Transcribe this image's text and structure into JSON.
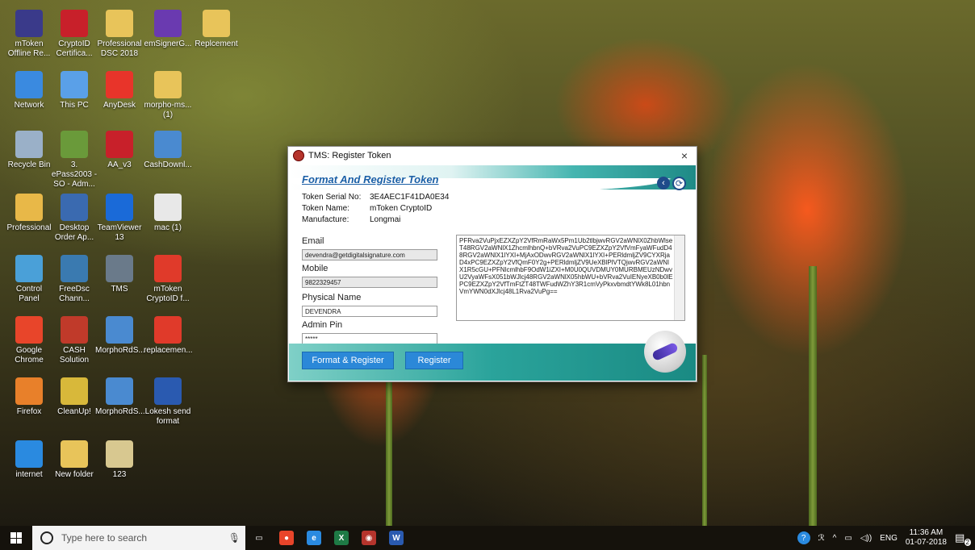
{
  "desktop": {
    "icons": [
      {
        "label": "mToken Offline Re...",
        "icon": "mtoken-icon",
        "color": "#3a3a8a"
      },
      {
        "label": "CryptoID Certifica...",
        "icon": "cryptoid-icon",
        "color": "#c8202a"
      },
      {
        "label": "Professional DSC 2018",
        "icon": "folder-zip-icon",
        "color": "#e8c45a"
      },
      {
        "label": "emSignerG...",
        "icon": "emsigner-icon",
        "color": "#6a3ab0"
      },
      {
        "label": "Replcement",
        "icon": "folder-zip-icon",
        "color": "#e8c45a"
      },
      {
        "label": "Network",
        "icon": "network-icon",
        "color": "#3a8ae0"
      },
      {
        "label": "This PC",
        "icon": "pc-icon",
        "color": "#5aa0e8"
      },
      {
        "label": "AnyDesk",
        "icon": "anydesk-icon",
        "color": "#e8342a"
      },
      {
        "label": "morpho-ms... (1)",
        "icon": "folder-zip-icon",
        "color": "#e8c45a"
      },
      {
        "label": "Recycle Bin",
        "icon": "recycle-bin-icon",
        "color": "#9ab0c8"
      },
      {
        "label": "3. ePass2003 - SO - Adm...",
        "icon": "epass-icon",
        "color": "#6a9a3a"
      },
      {
        "label": "AA_v3",
        "icon": "pdf-app-icon",
        "color": "#c8202a"
      },
      {
        "label": "CashDownl...",
        "icon": "installer-icon",
        "color": "#4a8ad0"
      },
      {
        "label": "Professional",
        "icon": "folder-user-icon",
        "color": "#e8b848"
      },
      {
        "label": "Desktop Order Ap...",
        "icon": "app-icon",
        "color": "#3a6ab0"
      },
      {
        "label": "TeamViewer 13",
        "icon": "teamviewer-icon",
        "color": "#1a6ad8"
      },
      {
        "label": "mac (1)",
        "icon": "file-icon",
        "color": "#e8e8e8"
      },
      {
        "label": "Control Panel",
        "icon": "control-panel-icon",
        "color": "#4aa0d8"
      },
      {
        "label": "FreeDsc Chann...",
        "icon": "freedsc-icon",
        "color": "#3a7ab0"
      },
      {
        "label": "TMS",
        "icon": "tms-icon",
        "color": "#6a7a8a"
      },
      {
        "label": "mToken CryptoID f...",
        "icon": "pdf-icon",
        "color": "#e03a2a"
      },
      {
        "label": "Google Chrome",
        "icon": "chrome-icon",
        "color": "#e8452a"
      },
      {
        "label": "CASH Solution",
        "icon": "cash-icon",
        "color": "#c03a2a"
      },
      {
        "label": "MorphoRdS...",
        "icon": "installer-icon",
        "color": "#4a8ad0"
      },
      {
        "label": "replacemen...",
        "icon": "pdf-icon",
        "color": "#e03a2a"
      },
      {
        "label": "Firefox",
        "icon": "firefox-icon",
        "color": "#e8802a"
      },
      {
        "label": "CleanUp!",
        "icon": "cleanup-icon",
        "color": "#d8b83a"
      },
      {
        "label": "MorphoRdS...",
        "icon": "installer-icon",
        "color": "#4a8ad0"
      },
      {
        "label": "Lokesh send format",
        "icon": "word-icon",
        "color": "#2a5ab0"
      },
      {
        "label": "internet",
        "icon": "ie-icon",
        "color": "#2a8ae0"
      },
      {
        "label": "New folder",
        "icon": "folder-icon",
        "color": "#e8c45a"
      },
      {
        "label": "123",
        "icon": "certificate-icon",
        "color": "#d8c890"
      }
    ]
  },
  "dialog": {
    "title": "TMS: Register Token",
    "close_glyph": "×",
    "header_title": "Format And Register Token",
    "back_glyph": "‹",
    "info": [
      {
        "label": "Token Serial No:",
        "value": "3E4AEC1F41DA0E34"
      },
      {
        "label": "Token Name:",
        "value": "mToken CryptoID"
      },
      {
        "label": "Manufacture:",
        "value": "Longmai"
      }
    ],
    "fields": {
      "email_label": "Email",
      "email_value": "devendra@getdigitalsignature.com",
      "mobile_label": "Mobile",
      "mobile_value": "9822329457",
      "physical_name_label": "Physical Name",
      "physical_name_value": "DEVENDRA",
      "admin_pin_label": "Admin Pin",
      "admin_pin_value": "*****"
    },
    "textarea_value": "PFRva2VuPjxEZXZpY2VfRmRaWx5Pm1Ub2tlbjwvRGV2aWNlX0ZhbWlseT48RGV2aWNlX1ZhcmlhbnQ+bVRva2VuPC9EZXZpY2VfVmFyaWFudD48RGV2aWNlX1lYXI+MjAxODwvRGV2aWNlX1lYXI+PERldmljZV9CYXRjaD4xPC9EZXZpY2VfQmF0Y2g+PERldmljZV9UeXBlPlVTQjwvRGV2aWNlX1R5cGU+PFNlcmlhbF9OdW1iZXI+M0U0QUVDMUY0MURBMEUzNDwvU2VyaWFsX051bWJlcj48RGV2aWNlX05hbWU+bVRva2VuIENyeXB0b0lEPC9EZXZpY2VfTmFtZT48TWFudWZhY3R1cmVyPkxvbmdtYWk8L01hbnVmYWN0dXJlcj48L1Rva2VuPg==",
    "buttons": {
      "format_register": "Format & Register",
      "register": "Register"
    }
  },
  "taskbar": {
    "search_placeholder": "Type here to search",
    "apps": [
      {
        "name": "task-view",
        "glyph": "▭",
        "color": "#15120c"
      },
      {
        "name": "chrome",
        "glyph": "●",
        "color": "#e8452a"
      },
      {
        "name": "ie",
        "glyph": "e",
        "color": "#2a8ae0"
      },
      {
        "name": "excel",
        "glyph": "X",
        "color": "#1e7a45"
      },
      {
        "name": "tms",
        "glyph": "◉",
        "color": "#b5342c"
      },
      {
        "name": "word",
        "glyph": "W",
        "color": "#2a5ab0"
      }
    ],
    "tray": {
      "user_glyph": "ℛ",
      "chevron": "^",
      "battery_glyph": "▭",
      "volume_glyph": "◁))",
      "language": "ENG",
      "time": "11:36 AM",
      "date": "01-07-2018",
      "notifications": "2"
    }
  }
}
